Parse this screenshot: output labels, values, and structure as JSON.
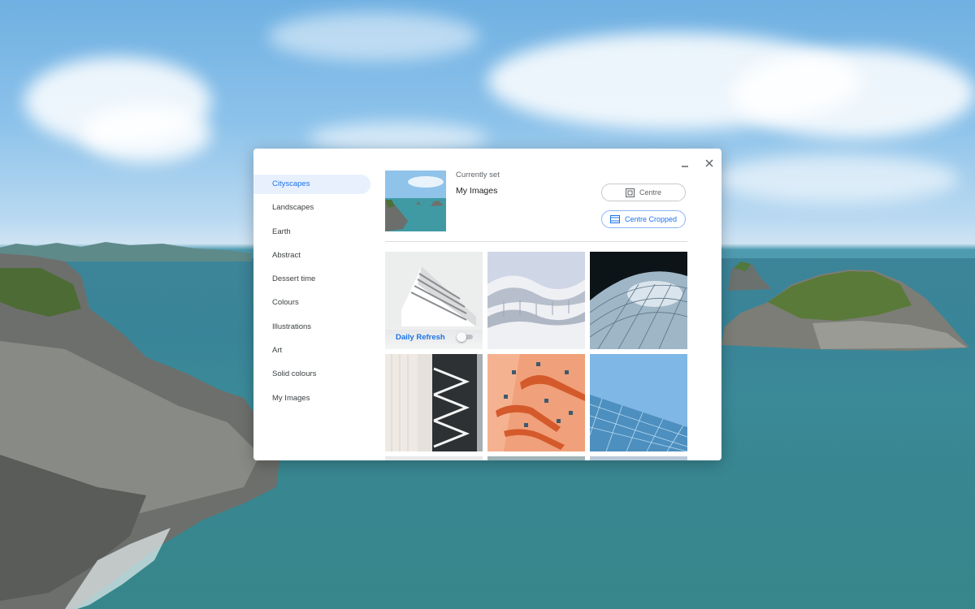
{
  "window": {
    "minimize_icon": "minimize-icon",
    "close_icon": "close-icon"
  },
  "sidebar": {
    "selected": "Cityscapes",
    "items": [
      {
        "label": "Cityscapes"
      },
      {
        "label": "Landscapes"
      },
      {
        "label": "Earth"
      },
      {
        "label": "Abstract"
      },
      {
        "label": "Dessert time"
      },
      {
        "label": "Colours"
      },
      {
        "label": "Illustrations"
      },
      {
        "label": "Art"
      },
      {
        "label": "Solid colours"
      },
      {
        "label": "My Images"
      }
    ]
  },
  "current": {
    "label": "Currently set",
    "collection": "My Images"
  },
  "layout_options": {
    "centre": {
      "label": "Centre",
      "icon": "centre-icon"
    },
    "centre_cropped": {
      "label": "Centre Cropped",
      "icon": "centre-cropped-icon",
      "selected": true
    }
  },
  "daily_refresh": {
    "label": "Daily Refresh",
    "enabled": false
  },
  "colors": {
    "accent": "#1a73e8",
    "selected_bg": "#e8f0fe",
    "toggle_off": "#bdc1c6"
  }
}
